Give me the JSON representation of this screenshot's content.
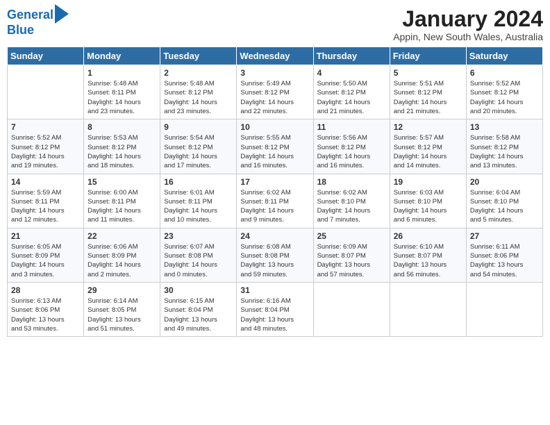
{
  "header": {
    "logo_line1": "General",
    "logo_line2": "Blue",
    "title": "January 2024",
    "subtitle": "Appin, New South Wales, Australia"
  },
  "days_of_week": [
    "Sunday",
    "Monday",
    "Tuesday",
    "Wednesday",
    "Thursday",
    "Friday",
    "Saturday"
  ],
  "weeks": [
    [
      {
        "day": "",
        "detail": ""
      },
      {
        "day": "1",
        "detail": "Sunrise: 5:48 AM\nSunset: 8:11 PM\nDaylight: 14 hours\nand 23 minutes."
      },
      {
        "day": "2",
        "detail": "Sunrise: 5:48 AM\nSunset: 8:12 PM\nDaylight: 14 hours\nand 23 minutes."
      },
      {
        "day": "3",
        "detail": "Sunrise: 5:49 AM\nSunset: 8:12 PM\nDaylight: 14 hours\nand 22 minutes."
      },
      {
        "day": "4",
        "detail": "Sunrise: 5:50 AM\nSunset: 8:12 PM\nDaylight: 14 hours\nand 21 minutes."
      },
      {
        "day": "5",
        "detail": "Sunrise: 5:51 AM\nSunset: 8:12 PM\nDaylight: 14 hours\nand 21 minutes."
      },
      {
        "day": "6",
        "detail": "Sunrise: 5:52 AM\nSunset: 8:12 PM\nDaylight: 14 hours\nand 20 minutes."
      }
    ],
    [
      {
        "day": "7",
        "detail": "Sunrise: 5:52 AM\nSunset: 8:12 PM\nDaylight: 14 hours\nand 19 minutes."
      },
      {
        "day": "8",
        "detail": "Sunrise: 5:53 AM\nSunset: 8:12 PM\nDaylight: 14 hours\nand 18 minutes."
      },
      {
        "day": "9",
        "detail": "Sunrise: 5:54 AM\nSunset: 8:12 PM\nDaylight: 14 hours\nand 17 minutes."
      },
      {
        "day": "10",
        "detail": "Sunrise: 5:55 AM\nSunset: 8:12 PM\nDaylight: 14 hours\nand 16 minutes."
      },
      {
        "day": "11",
        "detail": "Sunrise: 5:56 AM\nSunset: 8:12 PM\nDaylight: 14 hours\nand 16 minutes."
      },
      {
        "day": "12",
        "detail": "Sunrise: 5:57 AM\nSunset: 8:12 PM\nDaylight: 14 hours\nand 14 minutes."
      },
      {
        "day": "13",
        "detail": "Sunrise: 5:58 AM\nSunset: 8:12 PM\nDaylight: 14 hours\nand 13 minutes."
      }
    ],
    [
      {
        "day": "14",
        "detail": "Sunrise: 5:59 AM\nSunset: 8:11 PM\nDaylight: 14 hours\nand 12 minutes."
      },
      {
        "day": "15",
        "detail": "Sunrise: 6:00 AM\nSunset: 8:11 PM\nDaylight: 14 hours\nand 11 minutes."
      },
      {
        "day": "16",
        "detail": "Sunrise: 6:01 AM\nSunset: 8:11 PM\nDaylight: 14 hours\nand 10 minutes."
      },
      {
        "day": "17",
        "detail": "Sunrise: 6:02 AM\nSunset: 8:11 PM\nDaylight: 14 hours\nand 9 minutes."
      },
      {
        "day": "18",
        "detail": "Sunrise: 6:02 AM\nSunset: 8:10 PM\nDaylight: 14 hours\nand 7 minutes."
      },
      {
        "day": "19",
        "detail": "Sunrise: 6:03 AM\nSunset: 8:10 PM\nDaylight: 14 hours\nand 6 minutes."
      },
      {
        "day": "20",
        "detail": "Sunrise: 6:04 AM\nSunset: 8:10 PM\nDaylight: 14 hours\nand 5 minutes."
      }
    ],
    [
      {
        "day": "21",
        "detail": "Sunrise: 6:05 AM\nSunset: 8:09 PM\nDaylight: 14 hours\nand 3 minutes."
      },
      {
        "day": "22",
        "detail": "Sunrise: 6:06 AM\nSunset: 8:09 PM\nDaylight: 14 hours\nand 2 minutes."
      },
      {
        "day": "23",
        "detail": "Sunrise: 6:07 AM\nSunset: 8:08 PM\nDaylight: 14 hours\nand 0 minutes."
      },
      {
        "day": "24",
        "detail": "Sunrise: 6:08 AM\nSunset: 8:08 PM\nDaylight: 13 hours\nand 59 minutes."
      },
      {
        "day": "25",
        "detail": "Sunrise: 6:09 AM\nSunset: 8:07 PM\nDaylight: 13 hours\nand 57 minutes."
      },
      {
        "day": "26",
        "detail": "Sunrise: 6:10 AM\nSunset: 8:07 PM\nDaylight: 13 hours\nand 56 minutes."
      },
      {
        "day": "27",
        "detail": "Sunrise: 6:11 AM\nSunset: 8:06 PM\nDaylight: 13 hours\nand 54 minutes."
      }
    ],
    [
      {
        "day": "28",
        "detail": "Sunrise: 6:13 AM\nSunset: 8:06 PM\nDaylight: 13 hours\nand 53 minutes."
      },
      {
        "day": "29",
        "detail": "Sunrise: 6:14 AM\nSunset: 8:05 PM\nDaylight: 13 hours\nand 51 minutes."
      },
      {
        "day": "30",
        "detail": "Sunrise: 6:15 AM\nSunset: 8:04 PM\nDaylight: 13 hours\nand 49 minutes."
      },
      {
        "day": "31",
        "detail": "Sunrise: 6:16 AM\nSunset: 8:04 PM\nDaylight: 13 hours\nand 48 minutes."
      },
      {
        "day": "",
        "detail": ""
      },
      {
        "day": "",
        "detail": ""
      },
      {
        "day": "",
        "detail": ""
      }
    ]
  ]
}
